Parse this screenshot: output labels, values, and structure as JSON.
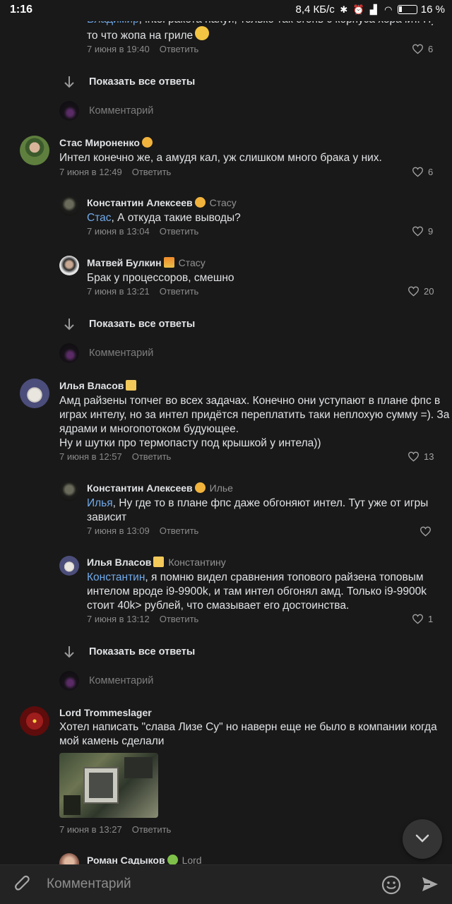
{
  "status_bar": {
    "time": "1:16",
    "speed": "8,4 КБ/с",
    "battery": "16 %"
  },
  "comments": {
    "top_partial": {
      "text_link": "Владимир",
      "text_rest": ", intel ракета нахуй, только так огонь с корпуса херачит. Ну",
      "text_line2": "то что жопа на гриле",
      "date": "7 июня в 19:40",
      "reply": "Ответить",
      "likes": "6"
    },
    "show_all_1": "Показать все ответы",
    "comment_placeholder_1": "Комментарий",
    "stas": {
      "name": "Стас Мироненко",
      "text": "Интел конечно же, а амудя кал, уж слишком много брака у них.",
      "date": "7 июня в 12:49",
      "reply": "Ответить",
      "likes": "6"
    },
    "konst1": {
      "name": "Константин Алексеев",
      "reply_to": "Стасу",
      "text_link": "Стас",
      "text_rest": ", А откуда такие выводы?",
      "date": "7 июня в 13:04",
      "reply": "Ответить",
      "likes": "9"
    },
    "matvey": {
      "name": "Матвей Булкин",
      "reply_to": "Стасу",
      "text": "Брак у процессоров, смешно",
      "date": "7 июня в 13:21",
      "reply": "Ответить",
      "likes": "20"
    },
    "show_all_2": "Показать все ответы",
    "comment_placeholder_2": "Комментарий",
    "ilya": {
      "name": "Илья Власов",
      "lines": [
        "Амд райзены топчег во всех задачах. Конечно они уступают в плане фпс в",
        "играх интелу, но за интел придётся переплатить таки неплохую сумму =). За",
        "ядрами и многопотоком будующее.",
        "Ну и шутки про термопасту под крышкой у интела))"
      ],
      "date": "7 июня в 12:57",
      "reply": "Ответить",
      "likes": "13"
    },
    "konst2": {
      "name": "Константин Алексеев",
      "reply_to": "Илье",
      "text_link": "Илья",
      "text_rest": ", Ну где то в плане фпс даже обгоняют интел. Тут уже от игры",
      "text_line2": "зависит",
      "date": "7 июня в 13:09",
      "reply": "Ответить"
    },
    "ilya2": {
      "name": "Илья Власов",
      "reply_to": "Константину",
      "text_link": "Константин",
      "text_rest": ", я помню видел сравнения топового райзена топовым",
      "lines": [
        "интелом вроде i9-9900k, и там интел обгонял амд. Только i9-9900k",
        "стоит 40k> рублей, что смазывает его достоинства."
      ],
      "date": "7 июня в 13:12",
      "reply": "Ответить",
      "likes": "1"
    },
    "show_all_3": "Показать все ответы",
    "comment_placeholder_3": "Комментарий",
    "lord": {
      "name": "Lord Trommeslager",
      "lines": [
        "Хотел написать \"слава Лизе Су\" но наверн еще не было в компании когда",
        "мой камень сделали"
      ],
      "date": "7 июня в 13:27",
      "reply": "Ответить"
    },
    "roman": {
      "name": "Роман Садыков",
      "reply_to": "Lord"
    }
  },
  "composer": {
    "placeholder": "Комментарий"
  },
  "colors": {
    "background": "#191919",
    "link": "#71aaeb",
    "text": "#e1e3e6",
    "muted": "#8a8a8a"
  }
}
